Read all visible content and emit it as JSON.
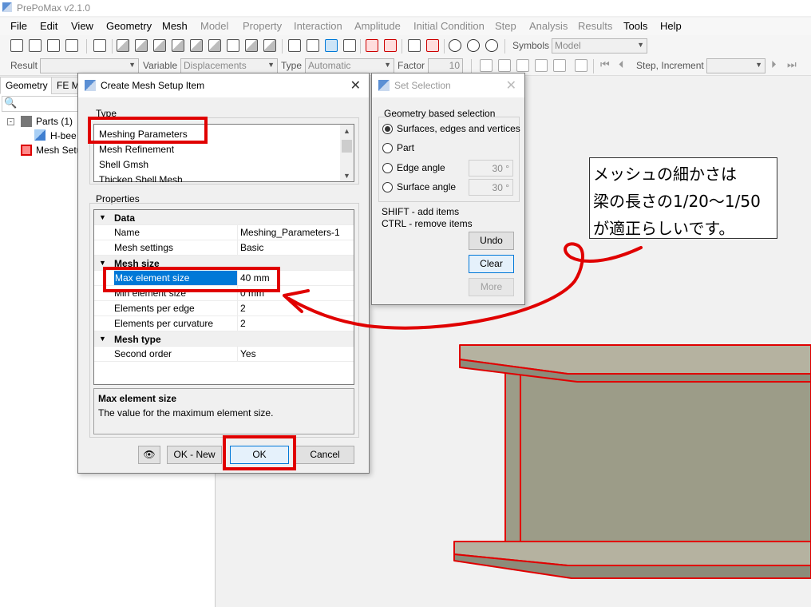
{
  "window": {
    "title": "PrePoMax v2.1.0"
  },
  "menu": [
    "File",
    "Edit",
    "View",
    "Geometry",
    "Mesh",
    "Model",
    "Property",
    "Interaction",
    "Amplitude",
    "Initial Condition",
    "Step",
    "Analysis",
    "Results",
    "Tools",
    "Help"
  ],
  "toolbar1": {
    "symbols_label": "Symbols",
    "symbols_value": "Model"
  },
  "toolbar2": {
    "result_label": "Result",
    "result_value": "",
    "variable_label": "Variable",
    "variable_value": "Displacements",
    "type_label": "Type",
    "type_value": "Automatic",
    "factor_label": "Factor",
    "factor_value": "10",
    "step_label": "Step, Increment",
    "step_value": ""
  },
  "left_tabs": [
    "Geometry",
    "FE M"
  ],
  "tree": {
    "parts": "Parts (1)",
    "part1": "H-bee",
    "mesh_setup": "Mesh Setu"
  },
  "dialog": {
    "title": "Create Mesh Setup Item",
    "type_label": "Type",
    "types": [
      "Meshing Parameters",
      "Mesh Refinement",
      "Shell Gmsh",
      "Thicken Shell Mesh"
    ],
    "properties_label": "Properties",
    "grid": {
      "data_cat": "Data",
      "name_label": "Name",
      "name_value": "Meshing_Parameters-1",
      "mesh_settings_label": "Mesh settings",
      "mesh_settings_value": "Basic",
      "mesh_size_cat": "Mesh size",
      "max_size_label": "Max element size",
      "max_size_value": "40 mm",
      "min_size_label": "Min element size",
      "min_size_value": "0 mm",
      "per_edge_label": "Elements per edge",
      "per_edge_value": "2",
      "per_curv_label": "Elements per curvature",
      "per_curv_value": "2",
      "mesh_type_cat": "Mesh type",
      "second_order_label": "Second order",
      "second_order_value": "Yes"
    },
    "desc_title": "Max element size",
    "desc_text": "The value for the maximum element size.",
    "ok_new": "OK - New",
    "ok": "OK",
    "cancel": "Cancel"
  },
  "selection": {
    "title": "Set Selection",
    "group": "Geometry based selection",
    "opt_surfaces": "Surfaces, edges and vertices",
    "opt_part": "Part",
    "opt_edge": "Edge angle",
    "edge_value": "30 °",
    "opt_surface": "Surface angle",
    "surface_value": "30 °",
    "hint1": "SHIFT - add items",
    "hint2": "CTRL - remove items",
    "undo": "Undo",
    "clear": "Clear",
    "more": "More"
  },
  "note": [
    "メッシュの細かさは",
    "梁の長さの1/20～1/50",
    "が適正らしいです。"
  ],
  "colors": {
    "annotation": "#e00000",
    "beam_fill": "#9c9c88",
    "beam_top": "#b5b2a0",
    "selection": "#0078d7"
  }
}
